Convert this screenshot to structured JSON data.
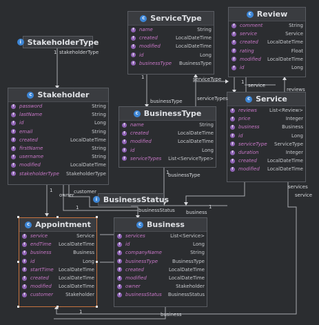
{
  "colors": {
    "background": "#2b2d30",
    "field_name": "#c978c8",
    "class_icon": "#3d86d6",
    "field_icon": "#8f63b5",
    "selection": "#c8743f"
  },
  "classes": {
    "service_type": {
      "name": "ServiceType",
      "icon": "c",
      "fields": [
        {
          "name": "name",
          "type": "String"
        },
        {
          "name": "created",
          "type": "LocalDateTime"
        },
        {
          "name": "modified",
          "type": "LocalDateTime"
        },
        {
          "name": "id",
          "type": "Long"
        },
        {
          "name": "businessType",
          "type": "BusinessType"
        }
      ]
    },
    "review": {
      "name": "Review",
      "icon": "c",
      "fields": [
        {
          "name": "comment",
          "type": "String"
        },
        {
          "name": "service",
          "type": "Service"
        },
        {
          "name": "created",
          "type": "LocalDateTime"
        },
        {
          "name": "rating",
          "type": "Float"
        },
        {
          "name": "modified",
          "type": "LocalDateTime"
        },
        {
          "name": "id",
          "type": "Long"
        }
      ]
    },
    "stakeholder_type": {
      "name": "StakeholderType",
      "icon": "i"
    },
    "stakeholder": {
      "name": "Stakeholder",
      "icon": "c",
      "fields": [
        {
          "name": "password",
          "type": "String"
        },
        {
          "name": "lastName",
          "type": "String"
        },
        {
          "name": "id",
          "type": "Long"
        },
        {
          "name": "email",
          "type": "String"
        },
        {
          "name": "created",
          "type": "LocalDateTime"
        },
        {
          "name": "firstName",
          "type": "String"
        },
        {
          "name": "username",
          "type": "String"
        },
        {
          "name": "modified",
          "type": "LocalDateTime"
        },
        {
          "name": "stakeholderType",
          "type": "StakeholderType"
        }
      ]
    },
    "business_type": {
      "name": "BusinessType",
      "icon": "c",
      "fields": [
        {
          "name": "name",
          "type": "String"
        },
        {
          "name": "created",
          "type": "LocalDateTime"
        },
        {
          "name": "modified",
          "type": "LocalDateTime"
        },
        {
          "name": "id",
          "type": "Long"
        },
        {
          "name": "serviceTypes",
          "type": "List<ServiceType>"
        }
      ]
    },
    "service": {
      "name": "Service",
      "icon": "c",
      "fields": [
        {
          "name": "reviews",
          "type": "List<Review>"
        },
        {
          "name": "price",
          "type": "Integer"
        },
        {
          "name": "business",
          "type": "Business"
        },
        {
          "name": "id",
          "type": "Long"
        },
        {
          "name": "serviceType",
          "type": "ServiceType"
        },
        {
          "name": "duration",
          "type": "Integer"
        },
        {
          "name": "created",
          "type": "LocalDateTime"
        },
        {
          "name": "modified",
          "type": "LocalDateTime"
        }
      ]
    },
    "business_status": {
      "name": "BusinessStatus",
      "icon": "i"
    },
    "appointment": {
      "name": "Appointment",
      "icon": "c",
      "fields": [
        {
          "name": "service",
          "type": "Service"
        },
        {
          "name": "endTime",
          "type": "LocalDateTime"
        },
        {
          "name": "business",
          "type": "Business"
        },
        {
          "name": "id",
          "type": "Long"
        },
        {
          "name": "startTime",
          "type": "LocalDateTime"
        },
        {
          "name": "created",
          "type": "LocalDateTime"
        },
        {
          "name": "modified",
          "type": "LocalDateTime"
        },
        {
          "name": "customer",
          "type": "Stakeholder"
        }
      ]
    },
    "business": {
      "name": "Business",
      "icon": "c",
      "fields": [
        {
          "name": "services",
          "type": "List<Service>"
        },
        {
          "name": "id",
          "type": "Long"
        },
        {
          "name": "companyName",
          "type": "String"
        },
        {
          "name": "businessType",
          "type": "BusinessType"
        },
        {
          "name": "created",
          "type": "LocalDateTime"
        },
        {
          "name": "modified",
          "type": "LocalDateTime"
        },
        {
          "name": "owner",
          "type": "Stakeholder"
        },
        {
          "name": "businessStatus",
          "type": "BusinessStatus"
        }
      ]
    }
  },
  "edge_labels": {
    "stakeholder_type": "stakeholderType",
    "stakeholder_type_mult": "1",
    "business_type": "businessType",
    "business_type_mult": "1",
    "service_type": "serviceType",
    "service_types": "serviceTypes",
    "service": "service",
    "reviews": "reviews",
    "business_type_2": "businessType",
    "customer": "customer",
    "owner": "owner",
    "business_status": "businessStatus",
    "business": "business",
    "services": "services",
    "service_2": "service",
    "business_2": "business",
    "one": "1"
  }
}
